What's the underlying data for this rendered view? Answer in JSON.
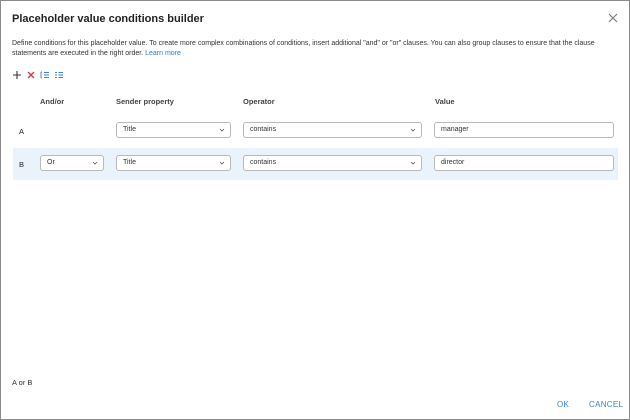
{
  "dialog": {
    "title": "Placeholder value conditions builder",
    "description": "Define conditions for this placeholder value. To create more complex combinations of conditions, insert additional \"and\" or \"or\" clauses. You can also group clauses to ensure that the clause statements are executed in the right order.",
    "learn_more": "Learn more"
  },
  "toolbar": {
    "icons": [
      "add-icon",
      "delete-icon",
      "group-icon",
      "ungroup-icon"
    ]
  },
  "columns": {
    "andor": "And/or",
    "property": "Sender property",
    "operator": "Operator",
    "value": "Value"
  },
  "rows": [
    {
      "label": "A",
      "andor": "",
      "property": "Title",
      "operator": "contains",
      "value": "manager"
    },
    {
      "label": "B",
      "andor": "Or",
      "property": "Title",
      "operator": "contains",
      "value": "director"
    }
  ],
  "formula": "A or B",
  "footer": {
    "ok": "OK",
    "cancel": "CANCEL"
  },
  "colors": {
    "accent": "#3b82d8",
    "row_highlight": "#eaf2fb",
    "delete": "#d9363e"
  }
}
